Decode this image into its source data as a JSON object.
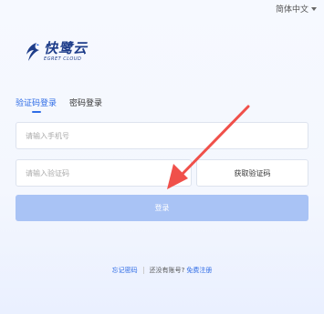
{
  "language": {
    "label": "简体中文"
  },
  "logo": {
    "brand": "快鹭云",
    "subtitle": "EGRET CLOUD"
  },
  "tabs": [
    {
      "label": "验证码登录",
      "active": true
    },
    {
      "label": "密码登录",
      "active": false
    }
  ],
  "form": {
    "phone_placeholder": "请输入手机号",
    "code_placeholder": "请输入验证码",
    "get_code_label": "获取验证码",
    "login_label": "登录"
  },
  "footer": {
    "forgot_label": "忘记密码",
    "no_account_text": "还没有账号?",
    "register_label": "免费注册"
  },
  "colors": {
    "accent": "#2f6ce6",
    "button_disabled": "#a9c3f5",
    "annotation_arrow": "#f0504a"
  }
}
